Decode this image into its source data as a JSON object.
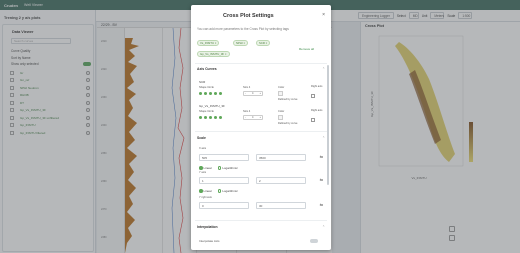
{
  "app": {
    "name": "Cruden",
    "menu": "Well Viewer"
  },
  "toolbar": {
    "tabs_label": "Engineering Logger",
    "select_label": "Select",
    "select_value": "MD",
    "unit_label": "Unit",
    "unit_value": "Meters",
    "scale_label": "Scale",
    "scale_value": "1:500"
  },
  "sidebar": {
    "well_title": "Trening 2 y a/s plots",
    "panel_title": "Data Viewer",
    "search_placeholder": "Search curves",
    "curve_quality_label": "Curve Quality",
    "sort_label": "Sort by Name",
    "show_selected_label": "Show only selected",
    "channels": [
      {
        "label": "Gr"
      },
      {
        "label": "Gn_ref"
      },
      {
        "label": "NPHI Neutron"
      },
      {
        "label": "RHOB"
      },
      {
        "label": "DT"
      },
      {
        "label": "Gp_Vs_INSITU_3F"
      },
      {
        "label": "Gp_Vs_INSITU_3F unfiltered"
      },
      {
        "label": "Gp_INSITU"
      },
      {
        "label": "Gp_INSITU filtered"
      }
    ]
  },
  "log": {
    "header": "22/29 - BV",
    "depth_ticks": [
      "2310",
      "2320",
      "2330",
      "2340",
      "2350",
      "2360",
      "2370",
      "2380"
    ]
  },
  "crossplot": {
    "title": "Cross Plot",
    "xlabel": "Vs_INSITU",
    "ylabel": "Gp_Vs_INSITU_3F"
  },
  "modal": {
    "title": "Cross Plot Settings",
    "close_symbol": "×",
    "subtitle": "You can add more parameters to the Cross Plot by selecting tags",
    "tags": [
      "Vs_INSITU ×",
      "NPHI ×",
      "SCR ×",
      "Gp_Vs_INSITU_3F ×"
    ],
    "remove_all": "Remove all",
    "axis_curves_title": "Axis Curves",
    "curves": [
      {
        "name": "SCR",
        "shape_label": "Shape Circle",
        "size_label": "Size 4",
        "size_value": "4",
        "color_label": "Color",
        "color_note": "Defined by curve",
        "right_axis_label": "Right axis"
      },
      {
        "name": "Gp_Vs_INSITU_3F",
        "shape_label": "Shape Circle",
        "size_label": "Size 4",
        "size_value": "4",
        "color_label": "Color",
        "color_note": "Defined by curve",
        "right_axis_label": "Right axis"
      }
    ],
    "scale_title": "Scale",
    "x_axis_label": "X axis",
    "x_min": "505",
    "x_max": "3500",
    "linear_label": "Linear",
    "log_label": "Logarithmic",
    "y_axis_label": "Y axis",
    "y_min": "1",
    "y_max": "2",
    "y_right_label": "Y right axis",
    "yr_min": "0",
    "yr_max": "30",
    "interpolation_title": "Interpolation",
    "interpolate_label": "Interpolate Axis"
  },
  "colors": {
    "brand": "#3d6b5e",
    "accent": "#5fa85a",
    "fill": "#b86f1c"
  }
}
